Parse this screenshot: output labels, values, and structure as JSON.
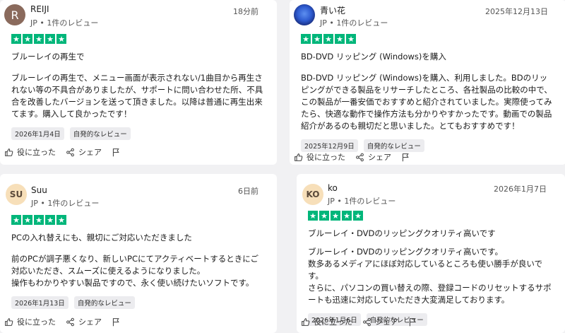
{
  "reviews": [
    {
      "avatar_text": "R",
      "name": "REIJI",
      "meta": "JP • 1件のレビュー",
      "date": "18分前",
      "title": "ブルーレイの再生で",
      "body": "ブルーレイの再生で、メニュー画面が表示されない/1曲目から再生されない等の不具合がありましたが、サポートに問い合わせた所、不具合を改善したバージョンを送って頂きました。以降は普通に再生出来てます。購入して良かったです！",
      "tag_date": "2026年1月4日",
      "tag_type": "自発的なレビュー",
      "rating": 5
    },
    {
      "avatar_text": "",
      "name": "青い花",
      "meta": "JP • 1件のレビュー",
      "date": "2025年12月13日",
      "title": "BD-DVD リッピング (Windows)を購入",
      "body": "BD-DVD リッピング (Windows)を購入、利用しました。BDのリッピングができる製品をリサーチしたところ、各社製品の比較の中で、この製品が一番安価でおすすめと紹介されていました。実際使ってみたら、快適な動作で操作方法も分かりやすかったです。動画での製品紹介があるのも親切だと思いました。とてもおすすめです！",
      "tag_date": "2025年12月9日",
      "tag_type": "自発的なレビュー",
      "rating": 5
    },
    {
      "avatar_text": "SU",
      "name": "Suu",
      "meta": "JP • 1件のレビュー",
      "date": "6日前",
      "title": "PCの入れ替えにも、親切にご対応いただきました",
      "body": "前のPCが調子悪くなり、新しいPCにてアクティベートするときにご対応いただき、スムーズに使えるようになりました。\n操作もわかりやすい製品ですので、永く使い続けたいソフトです。",
      "tag_date": "2026年1月13日",
      "tag_type": "自発的なレビュー",
      "rating": 5
    },
    {
      "avatar_text": "KO",
      "name": "ko",
      "meta": "JP • 1件のレビュー",
      "date": "2026年1月7日",
      "title": "ブルーレイ・DVDのリッピングクオリティ高いです",
      "body": "ブルーレイ・DVDのリッピングクオリティ高いです。\n数多あるメディアにほぼ対応しているところも使い勝手が良いです。\nさらに、パソコンの買い替えの際、登録コードのリセットするサポートも迅速に対応していただき大変満足しております。",
      "tag_date": "2026年1月6日",
      "tag_type": "自発的なレビュー",
      "rating": 5
    }
  ],
  "actions": {
    "useful": "役に立った",
    "share": "シェア"
  },
  "colors": {
    "star_green": "#00b67a",
    "background": "#f1f1f3"
  }
}
